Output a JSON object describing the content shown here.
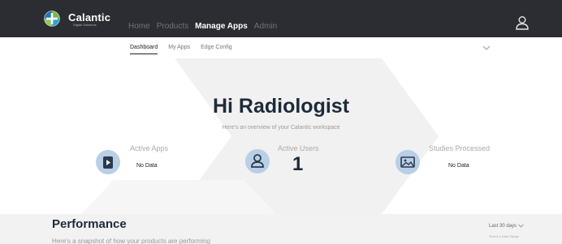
{
  "header": {
    "brand": "Calantic",
    "brand_sub": "Digital Solutions",
    "nav": [
      "Home",
      "Products",
      "Manage Apps",
      "Admin"
    ],
    "active_nav": "Manage Apps"
  },
  "subnav": {
    "tabs": [
      "Dashboard",
      "My Apps",
      "Edge Config"
    ],
    "active_tab": "Dashboard"
  },
  "hero": {
    "title": "Hi Radiologist",
    "subtitle": "Here's an overview of your Calantic workspace"
  },
  "stats": {
    "active_apps": {
      "label": "Active Apps",
      "value": "No Data",
      "icon": "play-app-icon"
    },
    "active_users": {
      "label": "Active Users",
      "value": "1",
      "icon": "user-icon"
    },
    "studies_processed": {
      "label": "Studies Processed",
      "value": "No Data",
      "icon": "image-icon"
    }
  },
  "performance": {
    "title": "Performance",
    "subtitle": "Here's a snapshot of how your products are performing",
    "range_label": "Last 30 days",
    "range_hint": "Select a Date Range"
  },
  "colors": {
    "topbar": "#2b2d33",
    "accent_icon_bg": "#b8cfe6",
    "title_text": "#1e2a3a"
  }
}
